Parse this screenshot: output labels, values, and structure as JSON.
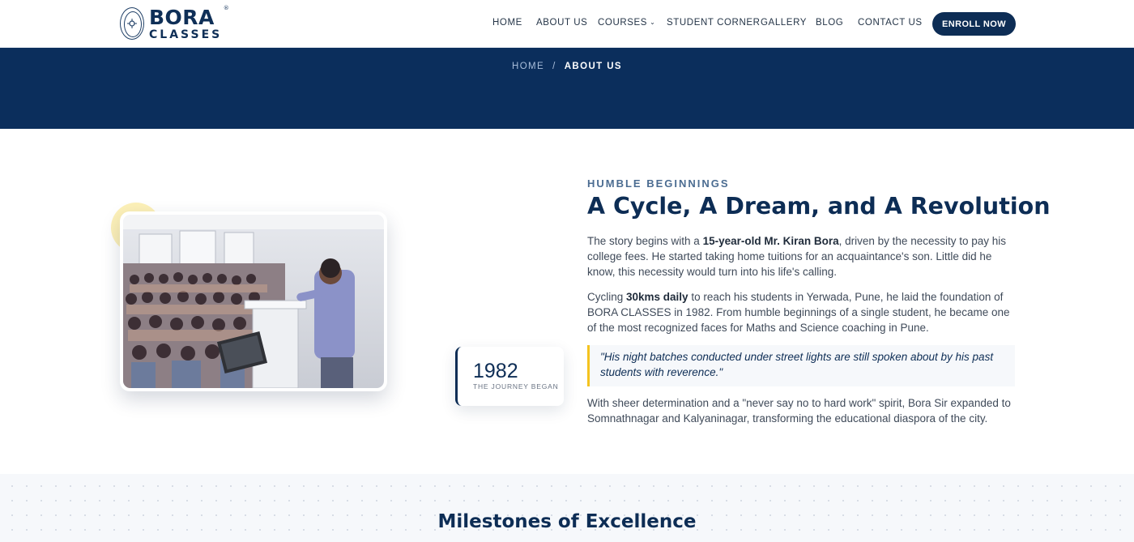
{
  "header": {
    "logo": {
      "brand": "BORA",
      "sub": "CLASSES",
      "mark": "®"
    },
    "nav": [
      {
        "label": "HOME"
      },
      {
        "label": "ABOUT US"
      },
      {
        "label": "COURSES",
        "has_dropdown": true
      },
      {
        "label": "STUDENT CORNER"
      },
      {
        "label": "GALLERY"
      },
      {
        "label": "BLOG"
      },
      {
        "label": "CONTACT US"
      }
    ],
    "cta_label": "ENROLL NOW"
  },
  "breadcrumb": {
    "home": "HOME",
    "separator": "/",
    "current": "ABOUT US"
  },
  "media": {
    "photo_icon": "classroom-photo",
    "year": "1982",
    "year_label": "THE JOURNEY BEGAN"
  },
  "story": {
    "eyebrow": "HUMBLE BEGINNINGS",
    "title": "A Cycle, A Dream, and A Revolution",
    "p1": {
      "pre": "The story begins with a ",
      "bold": "15-year-old Mr. Kiran Bora",
      "post": ", driven by the necessity to pay his college fees. He started taking home tuitions for an acquaintance's son. Little did he know, this necessity would turn into his life's calling."
    },
    "p2": {
      "pre": "Cycling ",
      "bold": "30kms daily",
      "post": " to reach his students in Yerwada, Pune, he laid the foundation of BORA CLASSES in 1982. From humble beginnings of a single student, he became one of the most recognized faces for Maths and Science coaching in Pune."
    },
    "quote": "\"His night batches conducted under street lights are still spoken about by his past students with reverence.\"",
    "p3": "With sheer determination and a \"never say no to hard work\" spirit, Bora Sir expanded to Somnathnagar and Kalyaninagar, transforming the educational diaspora of the city."
  },
  "milestones": {
    "title": "Milestones of Excellence"
  },
  "colors": {
    "navy": "#0d2d55",
    "banner": "#0b2e5c",
    "accent_yellow": "#f4c31f"
  }
}
